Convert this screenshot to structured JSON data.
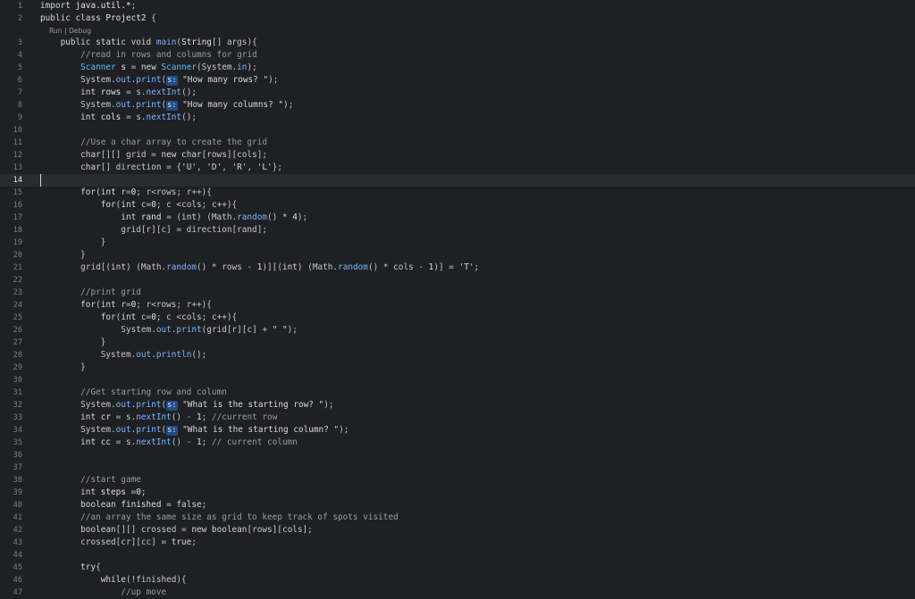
{
  "editor": {
    "codelens": "Run | Debug",
    "current_line": 14,
    "lines": [
      {
        "n": "1",
        "tokens": [
          [
            "kw",
            "import "
          ],
          [
            "ty",
            "java.util.*"
          ],
          [
            "op",
            ";"
          ]
        ]
      },
      {
        "n": "2",
        "tokens": [
          [
            "kw",
            "public class "
          ],
          [
            "ty",
            "Project2"
          ],
          [
            "op",
            " {"
          ]
        ]
      },
      {
        "n": "3",
        "tokens": [
          [
            "kw",
            "    public static void "
          ],
          [
            "fn",
            "main"
          ],
          [
            "op",
            "("
          ],
          [
            "ty",
            "String"
          ],
          [
            "op",
            "[] args)"
          ],
          [
            "op",
            "{"
          ]
        ]
      },
      {
        "n": "4",
        "tokens": [
          [
            "cm",
            "        //read in rows and columns for grid"
          ]
        ]
      },
      {
        "n": "5",
        "tokens": [
          [
            "ty2",
            "        Scanner "
          ],
          [
            "nb",
            "s"
          ],
          [
            "op",
            " = "
          ],
          [
            "kw",
            "new "
          ],
          [
            "ty2",
            "Scanner"
          ],
          [
            "op",
            "(System."
          ],
          [
            "fn",
            "in"
          ],
          [
            "op",
            ");"
          ]
        ]
      },
      {
        "n": "6",
        "tokens": [
          [
            "op",
            "        System."
          ],
          [
            "fn",
            "out"
          ],
          [
            "op",
            "."
          ],
          [
            "fn",
            "print"
          ],
          [
            "op",
            "("
          ],
          [
            "hint",
            "s:"
          ],
          [
            "st",
            " \"How many rows? \""
          ],
          [
            "op",
            ");"
          ]
        ]
      },
      {
        "n": "7",
        "tokens": [
          [
            "kw",
            "        int "
          ],
          [
            "nb",
            "rows"
          ],
          [
            "op",
            " = s."
          ],
          [
            "fn",
            "nextInt"
          ],
          [
            "op",
            "();"
          ]
        ]
      },
      {
        "n": "8",
        "tokens": [
          [
            "op",
            "        System."
          ],
          [
            "fn",
            "out"
          ],
          [
            "op",
            "."
          ],
          [
            "fn",
            "print"
          ],
          [
            "op",
            "("
          ],
          [
            "hint",
            "s:"
          ],
          [
            "st",
            " \"How many columns? \""
          ],
          [
            "op",
            ");"
          ]
        ]
      },
      {
        "n": "9",
        "tokens": [
          [
            "kw",
            "        int "
          ],
          [
            "nb",
            "cols"
          ],
          [
            "op",
            " = s."
          ],
          [
            "fn",
            "nextInt"
          ],
          [
            "op",
            "();"
          ]
        ]
      },
      {
        "n": "10",
        "tokens": []
      },
      {
        "n": "11",
        "tokens": [
          [
            "cm",
            "        //Use a char array to create the grid"
          ]
        ]
      },
      {
        "n": "12",
        "tokens": [
          [
            "kw",
            "        char"
          ],
          [
            "op",
            "[][] grid = "
          ],
          [
            "kw",
            "new char"
          ],
          [
            "op",
            "[rows][cols];"
          ]
        ]
      },
      {
        "n": "13",
        "tokens": [
          [
            "kw",
            "        char"
          ],
          [
            "op",
            "[] direction = {"
          ],
          [
            "st",
            "'U'"
          ],
          [
            "op",
            ", "
          ],
          [
            "st",
            "'D'"
          ],
          [
            "op",
            ", "
          ],
          [
            "st",
            "'R'"
          ],
          [
            "op",
            ", "
          ],
          [
            "st",
            "'L'"
          ],
          [
            "op",
            "};"
          ]
        ]
      },
      {
        "n": "14",
        "tokens": []
      },
      {
        "n": "15",
        "tokens": [
          [
            "kw",
            "        for"
          ],
          [
            "op",
            "("
          ],
          [
            "kw",
            "int "
          ],
          [
            "op",
            "r="
          ],
          [
            "nb",
            "0"
          ],
          [
            "op",
            "; r<rows; r++){"
          ]
        ]
      },
      {
        "n": "16",
        "tokens": [
          [
            "kw",
            "            for"
          ],
          [
            "op",
            "("
          ],
          [
            "kw",
            "int "
          ],
          [
            "op",
            "c="
          ],
          [
            "nb",
            "0"
          ],
          [
            "op",
            "; c <cols; c++){"
          ]
        ]
      },
      {
        "n": "17",
        "tokens": [
          [
            "kw",
            "                int "
          ],
          [
            "nb",
            "rand"
          ],
          [
            "op",
            " = ("
          ],
          [
            "kw",
            "int"
          ],
          [
            "op",
            ") (Math."
          ],
          [
            "fn",
            "random"
          ],
          [
            "op",
            "() * "
          ],
          [
            "nb",
            "4"
          ],
          [
            "op",
            ");"
          ]
        ]
      },
      {
        "n": "18",
        "tokens": [
          [
            "op",
            "                grid[r][c] = direction[rand];"
          ]
        ]
      },
      {
        "n": "19",
        "tokens": [
          [
            "op",
            "            }"
          ]
        ]
      },
      {
        "n": "20",
        "tokens": [
          [
            "op",
            "        }"
          ]
        ]
      },
      {
        "n": "21",
        "tokens": [
          [
            "op",
            "        grid[("
          ],
          [
            "kw",
            "int"
          ],
          [
            "op",
            ") (Math."
          ],
          [
            "fn",
            "random"
          ],
          [
            "op",
            "() * rows - "
          ],
          [
            "nb",
            "1"
          ],
          [
            "op",
            ")][("
          ],
          [
            "kw",
            "int"
          ],
          [
            "op",
            ") (Math."
          ],
          [
            "fn",
            "random"
          ],
          [
            "op",
            "() * cols - "
          ],
          [
            "nb",
            "1"
          ],
          [
            "op",
            ")] = "
          ],
          [
            "st",
            "'T'"
          ],
          [
            "op",
            ";"
          ]
        ]
      },
      {
        "n": "22",
        "tokens": []
      },
      {
        "n": "23",
        "tokens": [
          [
            "cm",
            "        //print grid"
          ]
        ]
      },
      {
        "n": "24",
        "tokens": [
          [
            "kw",
            "        for"
          ],
          [
            "op",
            "("
          ],
          [
            "kw",
            "int "
          ],
          [
            "op",
            "r="
          ],
          [
            "nb",
            "0"
          ],
          [
            "op",
            "; r<rows; r++){"
          ]
        ]
      },
      {
        "n": "25",
        "tokens": [
          [
            "kw",
            "            for"
          ],
          [
            "op",
            "("
          ],
          [
            "kw",
            "int "
          ],
          [
            "op",
            "c="
          ],
          [
            "nb",
            "0"
          ],
          [
            "op",
            "; c <cols; c++){"
          ]
        ]
      },
      {
        "n": "26",
        "tokens": [
          [
            "op",
            "                System."
          ],
          [
            "fn",
            "out"
          ],
          [
            "op",
            "."
          ],
          [
            "fn",
            "print"
          ],
          [
            "op",
            "(grid[r][c] + "
          ],
          [
            "st",
            "\" \""
          ],
          [
            "op",
            ");"
          ]
        ]
      },
      {
        "n": "27",
        "tokens": [
          [
            "op",
            "            }"
          ]
        ]
      },
      {
        "n": "28",
        "tokens": [
          [
            "op",
            "            System."
          ],
          [
            "fn",
            "out"
          ],
          [
            "op",
            "."
          ],
          [
            "fn",
            "println"
          ],
          [
            "op",
            "();"
          ]
        ]
      },
      {
        "n": "29",
        "tokens": [
          [
            "op",
            "        }"
          ]
        ]
      },
      {
        "n": "30",
        "tokens": []
      },
      {
        "n": "31",
        "tokens": [
          [
            "cm",
            "        //Get starting row and column"
          ]
        ]
      },
      {
        "n": "32",
        "tokens": [
          [
            "op",
            "        System."
          ],
          [
            "fn",
            "out"
          ],
          [
            "op",
            "."
          ],
          [
            "fn",
            "print"
          ],
          [
            "op",
            "("
          ],
          [
            "hint",
            "s:"
          ],
          [
            "st",
            " \"What is the starting row? \""
          ],
          [
            "op",
            ");"
          ]
        ]
      },
      {
        "n": "33",
        "tokens": [
          [
            "kw",
            "        int "
          ],
          [
            "nb",
            "cr"
          ],
          [
            "op",
            " = s."
          ],
          [
            "fn",
            "nextInt"
          ],
          [
            "op",
            "() - "
          ],
          [
            "nb",
            "1"
          ],
          [
            "op",
            "; "
          ],
          [
            "cm",
            "//current row"
          ]
        ]
      },
      {
        "n": "34",
        "tokens": [
          [
            "op",
            "        System."
          ],
          [
            "fn",
            "out"
          ],
          [
            "op",
            "."
          ],
          [
            "fn",
            "print"
          ],
          [
            "op",
            "("
          ],
          [
            "hint",
            "s:"
          ],
          [
            "st",
            " \"What is the starting column? \""
          ],
          [
            "op",
            ");"
          ]
        ]
      },
      {
        "n": "35",
        "tokens": [
          [
            "kw",
            "        int "
          ],
          [
            "nb",
            "cc"
          ],
          [
            "op",
            " = s."
          ],
          [
            "fn",
            "nextInt"
          ],
          [
            "op",
            "() - "
          ],
          [
            "nb",
            "1"
          ],
          [
            "op",
            "; "
          ],
          [
            "cm",
            "// current column"
          ]
        ]
      },
      {
        "n": "36",
        "tokens": []
      },
      {
        "n": "37",
        "tokens": []
      },
      {
        "n": "38",
        "tokens": [
          [
            "cm",
            "        //start game"
          ]
        ]
      },
      {
        "n": "39",
        "tokens": [
          [
            "kw",
            "        int "
          ],
          [
            "nb",
            "steps"
          ],
          [
            "op",
            " ="
          ],
          [
            "nb",
            "0"
          ],
          [
            "op",
            ";"
          ]
        ]
      },
      {
        "n": "40",
        "tokens": [
          [
            "kw",
            "        boolean "
          ],
          [
            "nb",
            "finished"
          ],
          [
            "op",
            " = "
          ],
          [
            "kw",
            "false"
          ],
          [
            "op",
            ";"
          ]
        ]
      },
      {
        "n": "41",
        "tokens": [
          [
            "cm",
            "        //an array the same size as grid to keep track of spots visited"
          ]
        ]
      },
      {
        "n": "42",
        "tokens": [
          [
            "kw",
            "        boolean"
          ],
          [
            "op",
            "[][] crossed = "
          ],
          [
            "kw",
            "new boolean"
          ],
          [
            "op",
            "[rows][cols];"
          ]
        ]
      },
      {
        "n": "43",
        "tokens": [
          [
            "op",
            "        crossed[cr][cc] = "
          ],
          [
            "kw",
            "true"
          ],
          [
            "op",
            ";"
          ]
        ]
      },
      {
        "n": "44",
        "tokens": []
      },
      {
        "n": "45",
        "tokens": [
          [
            "kw",
            "        try"
          ],
          [
            "op",
            "{"
          ]
        ]
      },
      {
        "n": "46",
        "tokens": [
          [
            "kw",
            "            while"
          ],
          [
            "op",
            "(!finished){"
          ]
        ]
      },
      {
        "n": "47",
        "tokens": [
          [
            "cm",
            "                //up move"
          ]
        ]
      }
    ]
  }
}
